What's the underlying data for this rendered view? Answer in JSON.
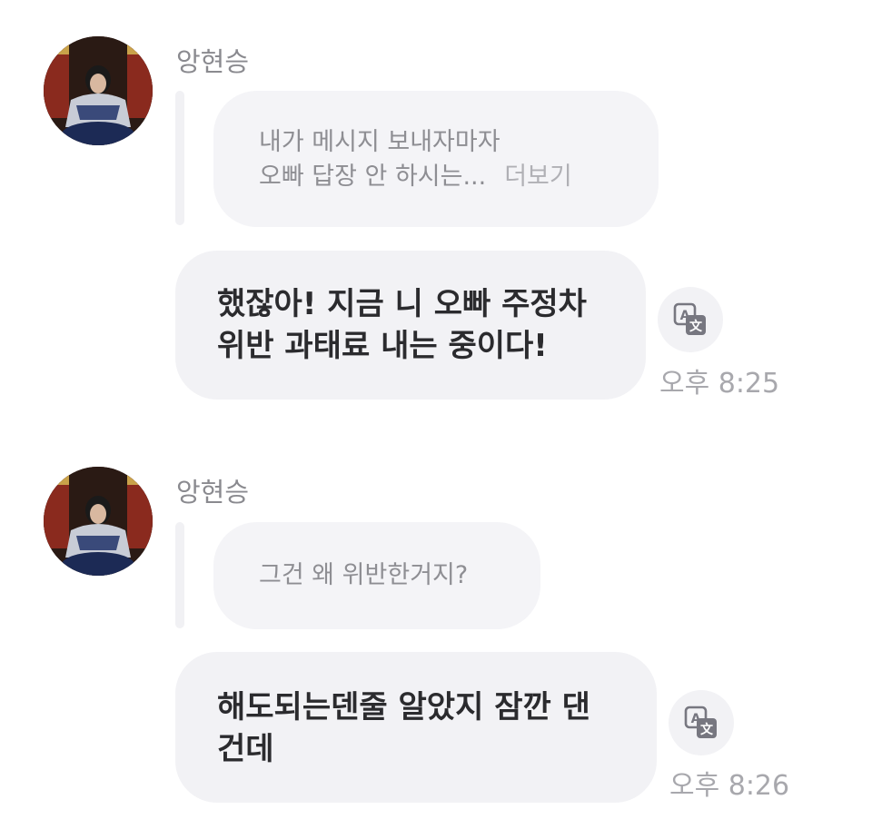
{
  "messages": [
    {
      "sender": "앙현승",
      "avatar_icon": "profile-photo",
      "quote": {
        "lines": [
          "내가 메시지 보내자마자",
          "오빠 답장 안 하시는..."
        ],
        "more_label": "더보기"
      },
      "reply_lines": [
        "했잖아! 지금 니 오빠 주정차",
        "위반 과태료 내는 중이다!"
      ],
      "translate_icon": "translate-icon",
      "time": "오후 8:25"
    },
    {
      "sender": "앙현승",
      "avatar_icon": "profile-photo",
      "quote": {
        "lines": [
          "그건 왜 위반한거지?"
        ],
        "more_label": ""
      },
      "reply_lines": [
        "해도되는덴줄 알았지 잠깐 댄",
        "건데"
      ],
      "translate_icon": "translate-icon",
      "time": "오후 8:26"
    }
  ],
  "colors": {
    "bubble": "#f2f2f5",
    "quote_text": "#8e8e93",
    "timestamp": "#a8a8ad",
    "sender": "#8a8a8f"
  }
}
